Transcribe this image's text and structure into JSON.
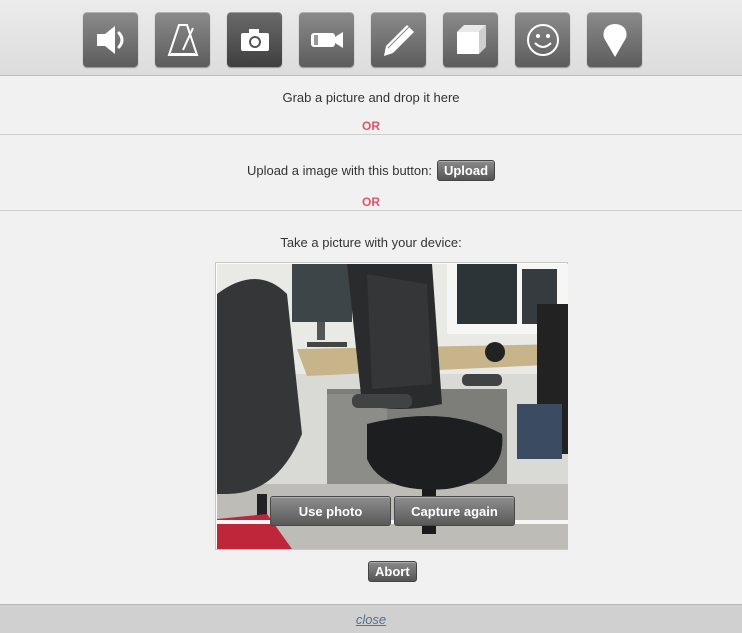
{
  "toolbar": {
    "tools": [
      {
        "icon": "speaker-icon"
      },
      {
        "icon": "metronome-icon"
      },
      {
        "icon": "camera-icon",
        "active": true
      },
      {
        "icon": "video-camera-icon"
      },
      {
        "icon": "pencil-icon"
      },
      {
        "icon": "cube-icon"
      },
      {
        "icon": "smiley-icon"
      },
      {
        "icon": "map-pin-icon"
      }
    ]
  },
  "drop": {
    "text": "Grab a picture and drop it here"
  },
  "or_text": "OR",
  "upload": {
    "text": "Upload a image with this button:",
    "button_label": "Upload"
  },
  "capture": {
    "text": "Take a picture with your device:",
    "use_photo_label": "Use photo",
    "capture_again_label": "Capture again",
    "abort_label": "Abort"
  },
  "footer": {
    "close_label": "close"
  },
  "colors": {
    "or_accent": "#e0556a",
    "button_dark": "#5d5d5d",
    "link": "#5a6f8a"
  }
}
